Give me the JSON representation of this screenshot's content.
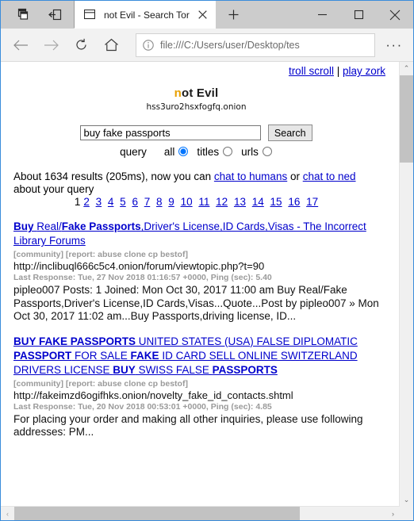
{
  "browser": {
    "tab_title": "not Evil - Search Tor",
    "address_value": "file:///C:/Users/user/Desktop/tes",
    "more_label": "···",
    "minimize_label": "─",
    "maximize_label": "□",
    "close_label": "✕",
    "newtab_label": "+",
    "tabclose_label": "✕"
  },
  "page": {
    "toplinks": {
      "troll_scroll": "troll scroll",
      "separator": " | ",
      "play_zork": "play zork"
    },
    "logo": {
      "first_letter": "n",
      "rest": "ot Evil",
      "onion_address": "hss3uro2hsxfogfq.onion"
    },
    "search": {
      "query_value": "buy fake passports",
      "button_label": "Search",
      "query_word": "query",
      "options": [
        {
          "label": "all",
          "checked": true
        },
        {
          "label": "titles",
          "checked": false
        },
        {
          "label": "urls",
          "checked": false
        }
      ]
    },
    "results_info": {
      "prefix": "About 1634 results (205ms), now you can ",
      "link1": "chat to humans",
      "middle": " or ",
      "link2": "chat to ned",
      "suffix": " about your query"
    },
    "pager": {
      "current": "1",
      "pages": [
        "2",
        "3",
        "4",
        "5",
        "6",
        "7",
        "8",
        "9",
        "10",
        "11",
        "12",
        "13",
        "14",
        "15",
        "16",
        "17"
      ]
    },
    "results": [
      {
        "title_parts": [
          {
            "text": "Buy ",
            "bold": true
          },
          {
            "text": "Real/",
            "bold": false
          },
          {
            "text": "Fake Passports",
            "bold": true
          },
          {
            "text": ",Driver's License,ID Cards,Visas - The Incorrect Library Forums",
            "bold": false
          }
        ],
        "tags": "[community] [report: abuse clone cp bestof]",
        "url": "http://inclibuql666c5c4.onion/forum/viewtopic.php?t=90",
        "meta": "Last Response: Tue, 27 Nov 2018 01:16:57 +0000, Ping (sec): 5.40",
        "snippet": "pipleo007 Posts: 1 Joined: Mon Oct 30, 2017 11:00 am Buy Real/Fake Passports,Driver's License,ID Cards,Visas...Quote...Post by pipleo007 » Mon Oct 30, 2017 11:02 am...Buy Passports,driving license, ID..."
      },
      {
        "title_parts": [
          {
            "text": "BUY FAKE PASSPORTS",
            "bold": true
          },
          {
            "text": " UNITED STATES (USA) FALSE DIPLOMATIC ",
            "bold": false
          },
          {
            "text": "PASSPORT",
            "bold": true
          },
          {
            "text": " FOR SALE ",
            "bold": false
          },
          {
            "text": "FAKE",
            "bold": true
          },
          {
            "text": " ID CARD SELL ONLINE SWITZERLAND DRIVERS LICENSE ",
            "bold": false
          },
          {
            "text": "BUY",
            "bold": true
          },
          {
            "text": " SWISS FALSE ",
            "bold": false
          },
          {
            "text": "PASSPORTS",
            "bold": true
          }
        ],
        "tags": "[community] [report: abuse clone cp bestof]",
        "url": "http://fakeimzd6ogifhks.onion/novelty_fake_id_contacts.shtml",
        "meta": "Last Response: Tue, 20 Nov 2018 00:53:01 +0000, Ping (sec): 4.85",
        "snippet": "  For placing your order and making all other inquiries, please use following addresses: PM..."
      }
    ],
    "scrollbar": {
      "up_arrow": "⌃",
      "down_arrow": "⌄",
      "left_arrow": "‹",
      "right_arrow": "›"
    }
  }
}
